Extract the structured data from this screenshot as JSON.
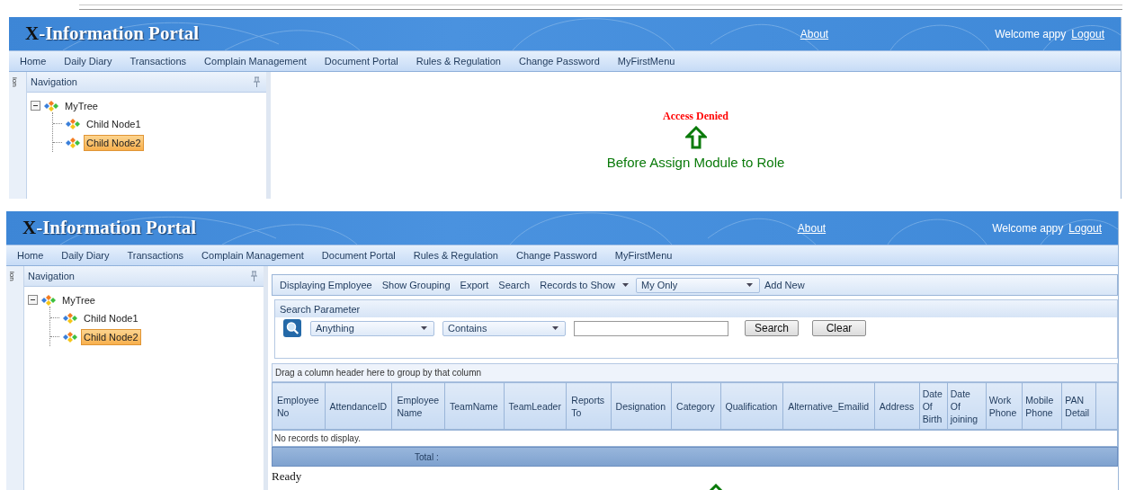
{
  "screens": [
    {
      "header": {
        "title_mark": "X",
        "title": "-Information Portal",
        "about": "About",
        "welcome": "Welcome appy",
        "logout": "Logout"
      },
      "menu": [
        "Home",
        "Daily Diary",
        "Transactions",
        "Complain Management",
        "Document Portal",
        "Rules & Regulation",
        "Change Password",
        "MyFirstMenu"
      ],
      "navigation": {
        "title": "Navigation",
        "strip_label": "ion",
        "tree": [
          {
            "label": "MyTree",
            "expanded": true,
            "selected": false,
            "children": [
              {
                "label": "Child Node1",
                "selected": false
              },
              {
                "label": "Child Node2",
                "selected": true
              }
            ]
          }
        ]
      },
      "content": {
        "kind": "access-denied",
        "message": "Access Denied",
        "caption": "Before Assign Module to Role"
      }
    },
    {
      "header": {
        "title_mark": "X",
        "title": "-Information Portal",
        "about": "About",
        "welcome": "Welcome appy",
        "logout": "Logout"
      },
      "menu": [
        "Home",
        "Daily Diary",
        "Transactions",
        "Complain Management",
        "Document Portal",
        "Rules & Regulation",
        "Change Password",
        "MyFirstMenu"
      ],
      "navigation": {
        "title": "Navigation",
        "strip_label": "ion",
        "tree": [
          {
            "label": "MyTree",
            "expanded": true,
            "selected": false,
            "children": [
              {
                "label": "Child Node1",
                "selected": false
              },
              {
                "label": "Child Node2",
                "selected": true
              }
            ]
          }
        ]
      },
      "content": {
        "kind": "employee-grid",
        "toolbar": {
          "items": [
            "Displaying Employee",
            "Show Grouping",
            "Export",
            "Search"
          ],
          "records_label": "Records to Show",
          "records_value": "My Only",
          "add_new": "Add New"
        },
        "search_panel": {
          "title": "Search Parameter",
          "field_select": "Anything",
          "operator_select": "Contains",
          "search_button": "Search",
          "clear_button": "Clear"
        },
        "group_hint": "Drag a column header here to group by that column",
        "columns": [
          "Employee No",
          "AttendanceID",
          "Employee Name",
          "TeamName",
          "TeamLeader",
          "Reports To",
          "Designation",
          "Category",
          "Qualification",
          "Alternative_Emailid",
          "Address",
          "Date Of Birth",
          "Date Of joining",
          "Work Phone",
          "Mobile Phone",
          "PAN Detail"
        ],
        "empty_message": "No records to display.",
        "footer_label": "Total :",
        "status": "Ready"
      }
    }
  ]
}
